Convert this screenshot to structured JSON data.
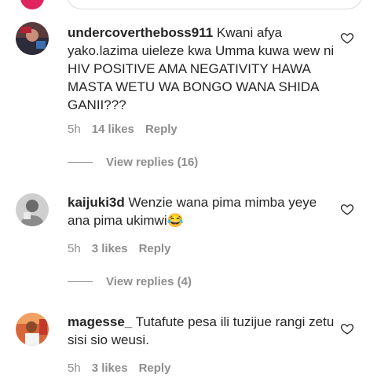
{
  "comments": [
    {
      "username": "undercovertheboss911",
      "text": "Kwani afya yako.lazima uieleze kwa Umma kuwa wew ni HIV POSITIVE AMA NEGATIVITY HAWA MASTA WETU WA BONGO WANA SHIDA GANII???",
      "time": "5h",
      "likes": "14 likes",
      "reply": "Reply",
      "view_replies": "View replies (16)"
    },
    {
      "username": "kaijuki3d",
      "text": "Wenzie wana pima mimba yeye ana pima ukimwi😂",
      "time": "5h",
      "likes": "3 likes",
      "reply": "Reply",
      "view_replies": "View replies (4)"
    },
    {
      "username": "magesse_",
      "text": "Tutafute pesa ili tuzijue rangi zetu sisi sio weusi.",
      "time": "5h",
      "likes": "3 likes",
      "reply": "Reply"
    }
  ],
  "icons": {
    "like": "heart-outline-icon"
  },
  "colors": {
    "muted": "#8e8e8e",
    "text": "#262626",
    "top_avatar": "#e0245e"
  }
}
